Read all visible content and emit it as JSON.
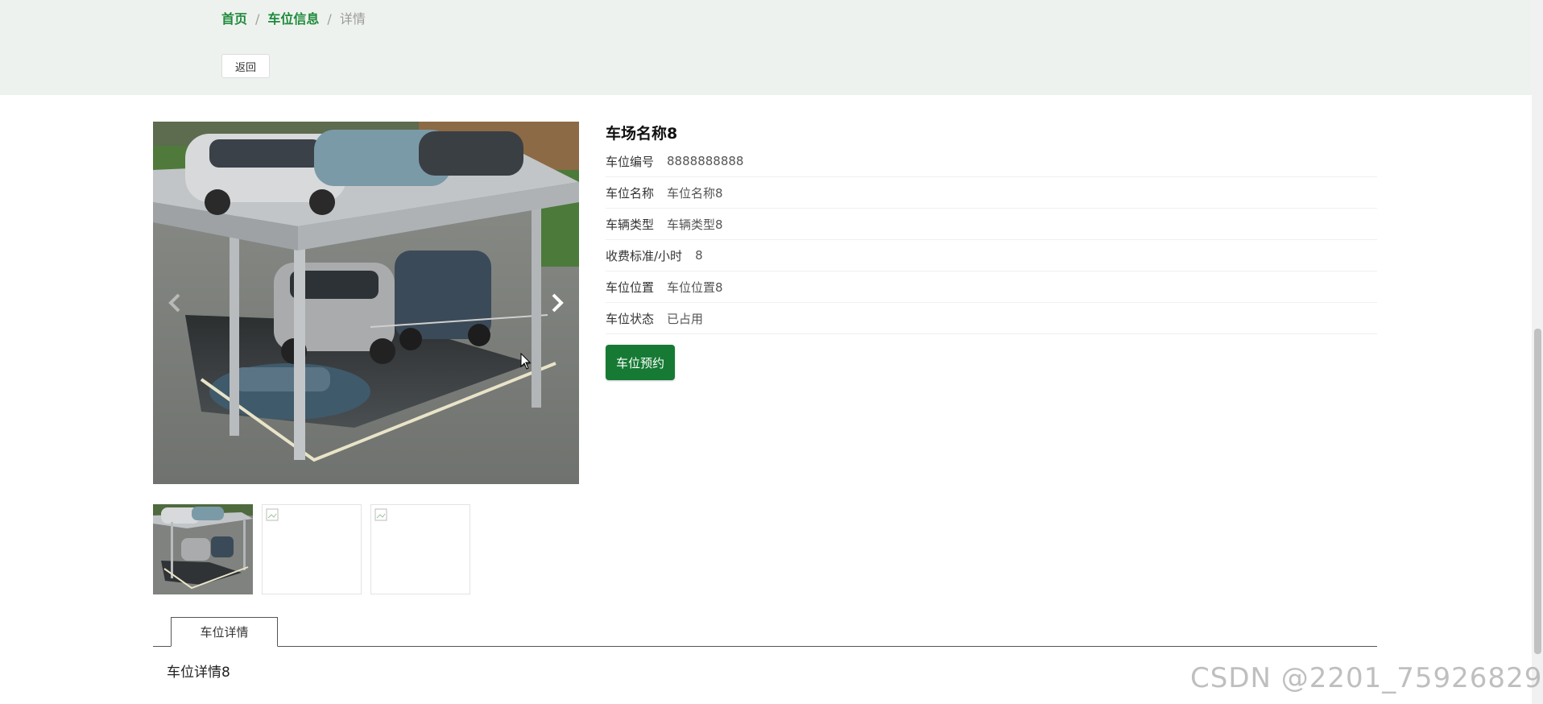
{
  "breadcrumb": {
    "home": "首页",
    "separator": "/",
    "section": "车位信息",
    "current": "详情"
  },
  "back_button": "返回",
  "lot": {
    "title": "车场名称8",
    "fields": [
      {
        "label": "车位编号",
        "value": "8888888888"
      },
      {
        "label": "车位名称",
        "value": "车位名称8"
      },
      {
        "label": "车辆类型",
        "value": "车辆类型8"
      },
      {
        "label": "收费标准/小时",
        "value": "8"
      },
      {
        "label": "车位位置",
        "value": "车位位置8"
      },
      {
        "label": "车位状态",
        "value": "已占用"
      }
    ],
    "reserve_button": "车位预约"
  },
  "tabs": [
    {
      "label": "车位详情"
    }
  ],
  "detail_text": "车位详情8",
  "watermark": "CSDN @2201_75926829",
  "colors": {
    "accent": "#167a34",
    "link": "#1e8a3c",
    "header_bg": "#eef2ee"
  }
}
